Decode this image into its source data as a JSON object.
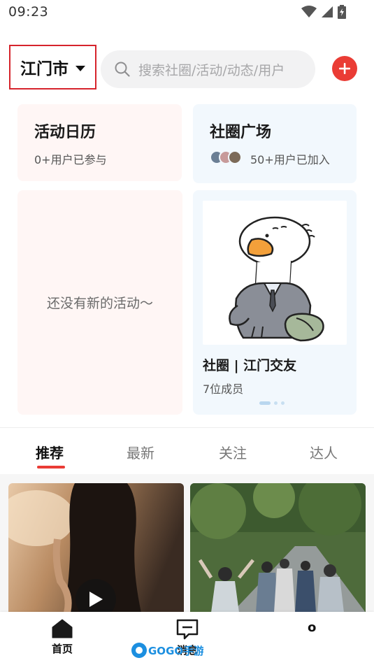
{
  "status_bar": {
    "time": "09:23",
    "icons": [
      "wifi-icon",
      "signal-icon",
      "battery-icon"
    ]
  },
  "header": {
    "city": "江门市",
    "search_placeholder": "搜索社圈/活动/动态/用户",
    "add_icon": "plus-circle-icon"
  },
  "cards": {
    "calendar": {
      "title": "活动日历",
      "subtitle": "0+用户已参与"
    },
    "square": {
      "title": "社圈广场",
      "subtitle": "50+用户已加入"
    },
    "empty_activity": {
      "text": "还没有新的活动～"
    },
    "circle": {
      "name": "社圈 | 江门交友",
      "members": "7位成员"
    }
  },
  "tabs": [
    {
      "label": "推荐",
      "active": true
    },
    {
      "label": "最新",
      "active": false
    },
    {
      "label": "关注",
      "active": false
    },
    {
      "label": "达人",
      "active": false
    }
  ],
  "bottom_nav": {
    "items": [
      {
        "label": "首页",
        "icon": "home-icon"
      },
      {
        "label": "消息",
        "icon": "message-icon"
      },
      {
        "label": "o",
        "icon": ""
      }
    ]
  },
  "watermark": {
    "text": "GOGO手游网"
  },
  "colors": {
    "accent": "#ea3c35",
    "highlight_border": "#d6242c",
    "pink_card": "#fff6f5",
    "blue_card": "#f2f8fd"
  }
}
